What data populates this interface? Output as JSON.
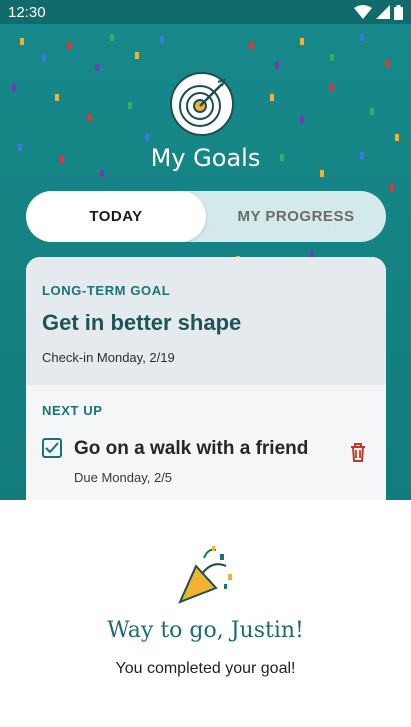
{
  "status_bar": {
    "time": "12:30"
  },
  "header": {
    "title": "My Goals"
  },
  "tabs": [
    {
      "label": "TODAY",
      "active": true
    },
    {
      "label": "MY PROGRESS",
      "active": false
    }
  ],
  "long_term_goal": {
    "section_label": "LONG-TERM GOAL",
    "title": "Get in better shape",
    "checkin": "Check-in Monday, 2/19"
  },
  "next_up": {
    "section_label": "NEXT UP",
    "item": {
      "title": "Go on a walk with a friend",
      "due": "Due Monday, 2/5",
      "checked": true
    }
  },
  "celebration": {
    "title": "Way to go, Justin!",
    "subtitle": "You completed your goal!"
  },
  "colors": {
    "teal_bg": "#1a8585",
    "teal_text": "#1a7373",
    "card_top": "#e5eaef",
    "trash": "#c0392b"
  },
  "icons": [
    "wifi-icon",
    "signal-icon",
    "battery-icon",
    "target-arrow-icon",
    "checkbox-icon",
    "trash-icon",
    "party-popper-icon"
  ]
}
